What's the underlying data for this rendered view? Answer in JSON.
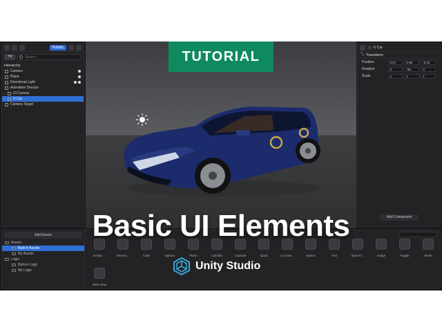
{
  "badge": {
    "text": "TUTORIAL",
    "color": "#0f8a5f"
  },
  "headline": "Basic UI Elements",
  "brand": {
    "name": "Unity Studio",
    "logo_icon": "unity-cube-icon"
  },
  "toolbar": {
    "publish_label": "Publish"
  },
  "hierarchy": {
    "search_placeholder": "Search...",
    "title": "Hierarchy",
    "items": [
      {
        "label": "Camera",
        "icon": "camera-icon"
      },
      {
        "label": "Plane",
        "icon": "plane-icon"
      },
      {
        "label": "Directional Light",
        "icon": "light-icon"
      },
      {
        "label": "Animation Director",
        "icon": "director-icon"
      },
      {
        "label": "UI Canvas",
        "icon": "canvas-icon"
      },
      {
        "label": "U Car",
        "icon": "object-icon",
        "selected": true
      },
      {
        "label": "Camera Target",
        "icon": "target-icon"
      }
    ]
  },
  "inspector": {
    "object_name": "U Car",
    "section_title": "Transform",
    "rows": [
      {
        "label": "Position",
        "values": [
          "0.07",
          "0.09",
          "-0.31"
        ]
      },
      {
        "label": "Rotation",
        "values": [
          "0",
          "-90",
          "0"
        ]
      },
      {
        "label": "Scale",
        "values": [
          "1",
          "1",
          "1"
        ]
      }
    ],
    "add_component_label": "Add Component"
  },
  "assets": {
    "add_label": "Add Assets",
    "tree": [
      {
        "label": "Assets",
        "indent": false
      },
      {
        "label": "Built-in Assets",
        "indent": true,
        "selected": true
      },
      {
        "label": "My Assets",
        "indent": true
      },
      {
        "label": "Logic",
        "indent": false
      },
      {
        "label": "Built-in Logic",
        "indent": true
      },
      {
        "label": "My Logic",
        "indent": true
      }
    ],
    "tiles": [
      {
        "label": "Empty ...",
        "icon": "empty-object-icon"
      },
      {
        "label": "Directio...",
        "icon": "light-icon"
      },
      {
        "label": "Cube",
        "icon": "cube-icon"
      },
      {
        "label": "Sphere",
        "icon": "sphere-icon"
      },
      {
        "label": "Plane",
        "icon": "plane-icon"
      },
      {
        "label": "Cylinder",
        "icon": "cylinder-icon"
      },
      {
        "label": "Capsule",
        "icon": "capsule-icon"
      },
      {
        "label": "Quad",
        "icon": "quad-icon"
      },
      {
        "label": "UI Canv...",
        "icon": "canvas-icon"
      },
      {
        "label": "Button",
        "icon": "button-icon"
      },
      {
        "label": "Text",
        "icon": "text-icon"
      },
      {
        "label": "Input Fi...",
        "icon": "input-field-icon"
      },
      {
        "label": "Image",
        "icon": "image-icon"
      },
      {
        "label": "Toggle",
        "icon": "toggle-icon"
      },
      {
        "label": "Slider",
        "icon": "slider-icon"
      },
      {
        "label": "Web View",
        "icon": "globe-icon"
      }
    ]
  },
  "colors": {
    "accent": "#2f6fd6",
    "car": "#1c2b6b",
    "highlight_ring": "#c9a64a"
  }
}
